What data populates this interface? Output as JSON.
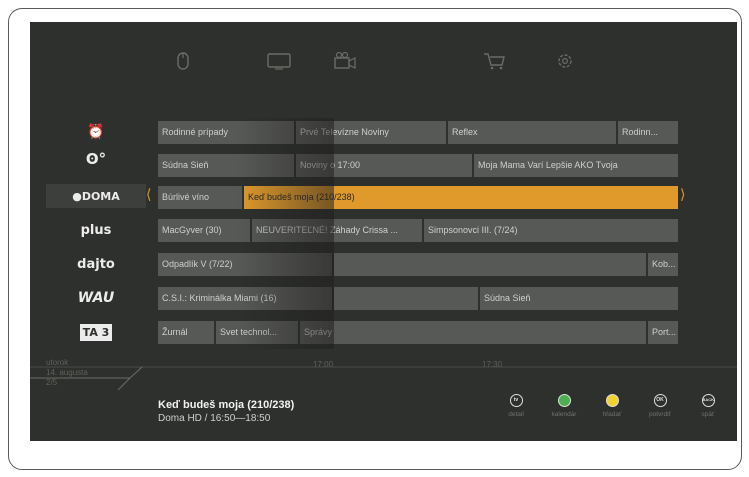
{
  "nav_icons": [
    "mouse-icon",
    "tv-icon",
    "video-camera-icon",
    "cart-icon",
    "settings-gear-icon"
  ],
  "channels": [
    {
      "name": "clock-channel",
      "label": "⏰",
      "selected": false
    },
    {
      "name": "markiza",
      "label": "ʘ°",
      "selected": false
    },
    {
      "name": "doma",
      "label": "●DOMA",
      "selected": true
    },
    {
      "name": "plus",
      "label": "plus",
      "selected": false
    },
    {
      "name": "dajto",
      "label": "dajto",
      "selected": false
    },
    {
      "name": "wau",
      "label": "WAU",
      "selected": false
    },
    {
      "name": "ta3",
      "label": "TA 3",
      "selected": false
    }
  ],
  "guide": {
    "row1": [
      "Rodinné prípady",
      "Prvé Televízne Noviny",
      "Reflex",
      "Rodinn..."
    ],
    "row2": [
      "Súdna Sieň",
      "Noviny o 17:00",
      "Moja Mama Varí Lepšie AKO Tvoja"
    ],
    "row3": [
      "Búrlivé víno",
      "Keď budeš moja (210/238)"
    ],
    "row4": [
      "MacGyver (30)",
      "NEUVERITEĽNÉ! Záhady Crissa ...",
      "Simpsonovci III. (7/24)"
    ],
    "row5": [
      "Odpadlík V (7/22)",
      "",
      "Kob..."
    ],
    "row6": [
      "C.S.I.: Kriminálka Miami (16)",
      "",
      "Súdna Sieň"
    ],
    "row7": [
      "Žurnál",
      "Svet technol...",
      "Správy",
      "Port..."
    ]
  },
  "times": [
    "17:00",
    "17:30"
  ],
  "date": {
    "day": "utorok",
    "date": "14. augusta",
    "page": "2/5"
  },
  "selected_program": {
    "title": "Keď budeš moja (210/238)",
    "details": "Doma HD / 16:50—18:50"
  },
  "buttons": [
    {
      "name": "detail",
      "icon": "tv",
      "label": "detail",
      "color": "#2e302d",
      "ring": "#e0e0e0"
    },
    {
      "name": "kalendar",
      "icon": "",
      "label": "kalendár",
      "color": "#4caf50",
      "ring": "#e0e0e0"
    },
    {
      "name": "hladat",
      "icon": "",
      "label": "hľadať",
      "color": "#f2d230",
      "ring": "#e0e0e0"
    },
    {
      "name": "potvrdit",
      "icon": "OK",
      "label": "potvrdiť",
      "color": "#2e302d",
      "ring": "#e0e0e0"
    },
    {
      "name": "spat",
      "icon": "BACK",
      "label": "späť",
      "color": "#2e302d",
      "ring": "#e0e0e0"
    }
  ],
  "colors": {
    "background": "#2e302d",
    "accent": "#e09a2b",
    "cell": "#575956"
  }
}
